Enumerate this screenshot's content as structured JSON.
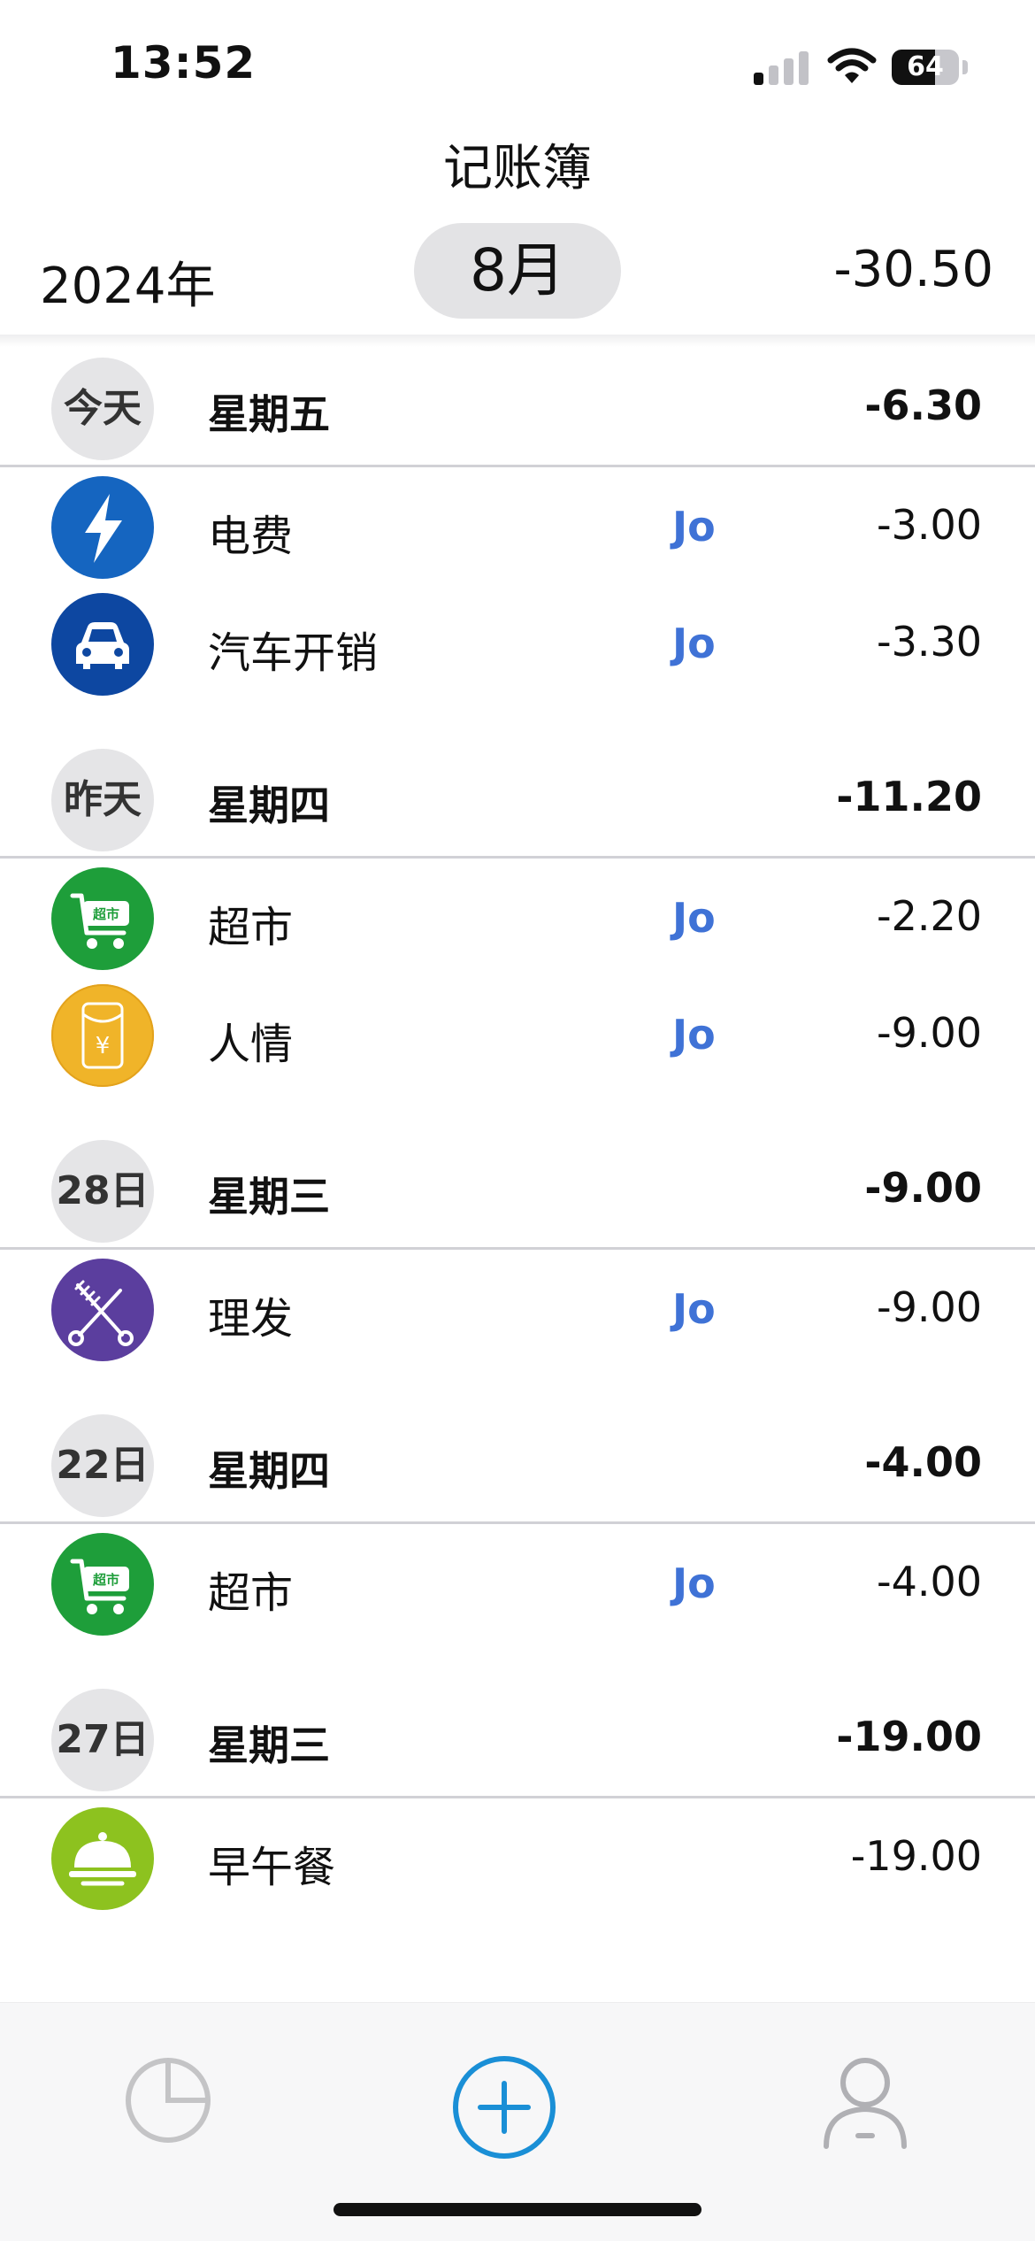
{
  "status_bar": {
    "time": "13:52",
    "battery": "64",
    "battery_level_pct": 64
  },
  "header": {
    "title": "记账簿",
    "year": "2024年",
    "month": "8月",
    "month_total": "-30.50"
  },
  "colors": {
    "user_tag": "#3f72d6",
    "electricity": "#1565c0",
    "car": "#0d47a1",
    "supermarket": "#1e9e3a",
    "gift": "#f0b429",
    "haircut": "#5b3e9e",
    "meal": "#8dc21f",
    "accent": "#1a8fd6"
  },
  "days": [
    {
      "badge": "今天",
      "weekday": "星期五",
      "total": "-6.30",
      "entries": [
        {
          "category": "电费",
          "icon": "lightning-icon",
          "user": "Jo",
          "amount": "-3.00"
        },
        {
          "category": "汽车开销",
          "icon": "car-icon",
          "user": "Jo",
          "amount": "-3.30"
        }
      ]
    },
    {
      "badge": "昨天",
      "weekday": "星期四",
      "total": "-11.20",
      "entries": [
        {
          "category": "超市",
          "icon": "shopping-cart-icon",
          "icon_text": "超市",
          "user": "Jo",
          "amount": "-2.20"
        },
        {
          "category": "人情",
          "icon": "red-envelope-icon",
          "icon_text": "¥",
          "user": "Jo",
          "amount": "-9.00"
        }
      ]
    },
    {
      "badge": "28日",
      "weekday": "星期三",
      "total": "-9.00",
      "entries": [
        {
          "category": "理发",
          "icon": "scissors-comb-icon",
          "user": "Jo",
          "amount": "-9.00"
        }
      ]
    },
    {
      "badge": "22日",
      "weekday": "星期四",
      "total": "-4.00",
      "entries": [
        {
          "category": "超市",
          "icon": "shopping-cart-icon",
          "icon_text": "超市",
          "user": "Jo",
          "amount": "-4.00"
        }
      ]
    },
    {
      "badge": "27日",
      "weekday": "星期三",
      "total": "-19.00",
      "entries": [
        {
          "category": "早午餐",
          "icon": "food-cloche-icon",
          "user": "",
          "amount": "-19.00"
        }
      ]
    }
  ],
  "tab_bar": {
    "items": [
      "pie-chart-icon",
      "add-circle-icon",
      "user-icon"
    ]
  }
}
